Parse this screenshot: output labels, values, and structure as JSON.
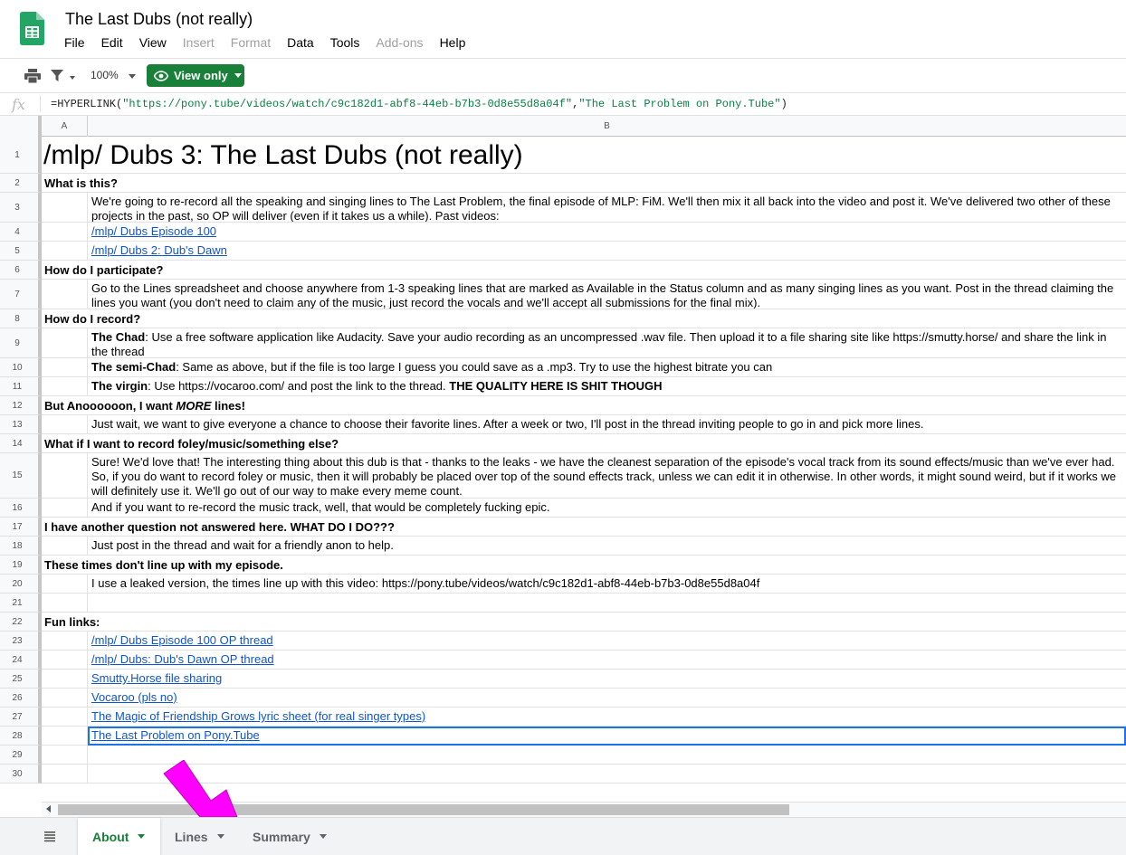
{
  "header": {
    "title": "The Last Dubs (not really)",
    "menu": [
      {
        "label": "File",
        "enabled": true
      },
      {
        "label": "Edit",
        "enabled": true
      },
      {
        "label": "View",
        "enabled": true
      },
      {
        "label": "Insert",
        "enabled": false
      },
      {
        "label": "Format",
        "enabled": false
      },
      {
        "label": "Data",
        "enabled": true
      },
      {
        "label": "Tools",
        "enabled": true
      },
      {
        "label": "Add-ons",
        "enabled": false
      },
      {
        "label": "Help",
        "enabled": true
      }
    ]
  },
  "toolbar": {
    "zoom": "100%",
    "view_only_label": "View only"
  },
  "formula_bar": {
    "fx": "fx",
    "prefix": "=HYPERLINK(",
    "arg1": "\"https://pony.tube/videos/watch/c9c182d1-abf8-44eb-b7b3-0d8e55d8a04f\"",
    "comma": ",",
    "arg2": "\"The Last Problem on Pony.Tube\"",
    "suffix": ")"
  },
  "columns": [
    "A",
    "B"
  ],
  "rows": [
    {
      "n": "1",
      "type": "title",
      "text": "/mlp/ Dubs 3: The Last Dubs (not really)"
    },
    {
      "n": "2",
      "type": "heading",
      "text": "What is this?"
    },
    {
      "n": "3",
      "type": "body",
      "text": "We're going to re-record all the speaking and singing lines to The Last Problem, the final episode of MLP: FiM.  We'll then mix it all back into the video and post it.  We've delivered two other of these projects in the past, so OP will deliver (even if it takes us a while).  Past videos:"
    },
    {
      "n": "4",
      "type": "link",
      "text": "/mlp/ Dubs Episode 100"
    },
    {
      "n": "5",
      "type": "link",
      "text": "/mlp/ Dubs 2: Dub's Dawn"
    },
    {
      "n": "6",
      "type": "heading",
      "text": "How do I participate?"
    },
    {
      "n": "7",
      "type": "body",
      "text": "Go to the Lines spreadsheet and choose anywhere from 1-3 speaking lines that are marked as Available in the Status column and as many singing lines as you want.  Post in the thread claiming the lines you want (you don't need to claim any of the music, just record the vocals and we'll accept all submissions for the final mix)."
    },
    {
      "n": "8",
      "type": "heading",
      "text": "How do I record?"
    },
    {
      "n": "9",
      "type": "rich",
      "bold": "The Chad",
      "text": ": Use a free software application like Audacity.  Save your audio recording as an uncompressed .wav file.  Then upload it to a file sharing site like https://smutty.horse/ and share the link in the thread"
    },
    {
      "n": "10",
      "type": "rich",
      "bold": "The semi-Chad",
      "text": ": Same as above, but if the file is too large I guess you could save as a .mp3.  Try to use the highest bitrate you can"
    },
    {
      "n": "11",
      "type": "rich",
      "bold": "The virgin",
      "text": ": Use https://vocaroo.com/ and post the link to the thread.  ",
      "tail_bold": "THE QUALITY HERE IS SHIT THOUGH"
    },
    {
      "n": "12",
      "type": "heading_rich",
      "pre": "But Anoooooon, I want ",
      "italic": "MORE",
      "post": " lines!"
    },
    {
      "n": "13",
      "type": "body",
      "text": "Just wait, we want to give everyone a chance to choose their favorite lines.  After a week or two, I'll post in the thread inviting people to go in and pick more lines."
    },
    {
      "n": "14",
      "type": "heading",
      "text": "What if I want to record foley/music/something else?"
    },
    {
      "n": "15",
      "type": "body",
      "text": "Sure!  We'd love that!  The interesting thing about this dub is that - thanks to the leaks - we have the cleanest separation of the episode's vocal track from its sound effects/music than we've ever had.  So, if you do want to record foley or music, then it will probably be placed over top of the sound effects track, unless we can edit it in otherwise.  In other words, it might sound weird, but if it works we will definitely use it.  We'll go out of our way to make every meme count."
    },
    {
      "n": "16",
      "type": "body",
      "text": "And if you want to re-record the music track, well, that would be completely fucking epic."
    },
    {
      "n": "17",
      "type": "heading",
      "text": "I have another question not answered here.  WHAT DO I DO???"
    },
    {
      "n": "18",
      "type": "body",
      "text": "Just post in the thread and wait for a friendly anon to help."
    },
    {
      "n": "19",
      "type": "heading",
      "text": "These times don't line up with my episode."
    },
    {
      "n": "20",
      "type": "body",
      "text": "I use a leaked version, the times line up with this video: https://pony.tube/videos/watch/c9c182d1-abf8-44eb-b7b3-0d8e55d8a04f"
    },
    {
      "n": "21",
      "type": "empty",
      "text": ""
    },
    {
      "n": "22",
      "type": "heading",
      "text": "Fun links:"
    },
    {
      "n": "23",
      "type": "link",
      "text": "/mlp/ Dubs Episode 100 OP thread"
    },
    {
      "n": "24",
      "type": "link",
      "text": "/mlp/ Dubs: Dub's Dawn OP thread"
    },
    {
      "n": "25",
      "type": "link",
      "text": "Smutty.Horse file sharing"
    },
    {
      "n": "26",
      "type": "link",
      "text": "Vocaroo (pls no)"
    },
    {
      "n": "27",
      "type": "link",
      "text": "The Magic of Friendship Grows lyric sheet (for real singer types)"
    },
    {
      "n": "28",
      "type": "link",
      "text": "The Last Problem on Pony.Tube",
      "selected": true
    },
    {
      "n": "29",
      "type": "empty",
      "text": ""
    },
    {
      "n": "30",
      "type": "empty",
      "text": ""
    }
  ],
  "sheets": [
    {
      "label": "About",
      "active": true
    },
    {
      "label": "Lines",
      "active": false
    },
    {
      "label": "Summary",
      "active": false
    }
  ],
  "colors": {
    "accent_green": "#188038",
    "link_blue": "#1155cc",
    "selection_blue": "#1a73e8",
    "annotation_magenta": "#ff00ff"
  }
}
